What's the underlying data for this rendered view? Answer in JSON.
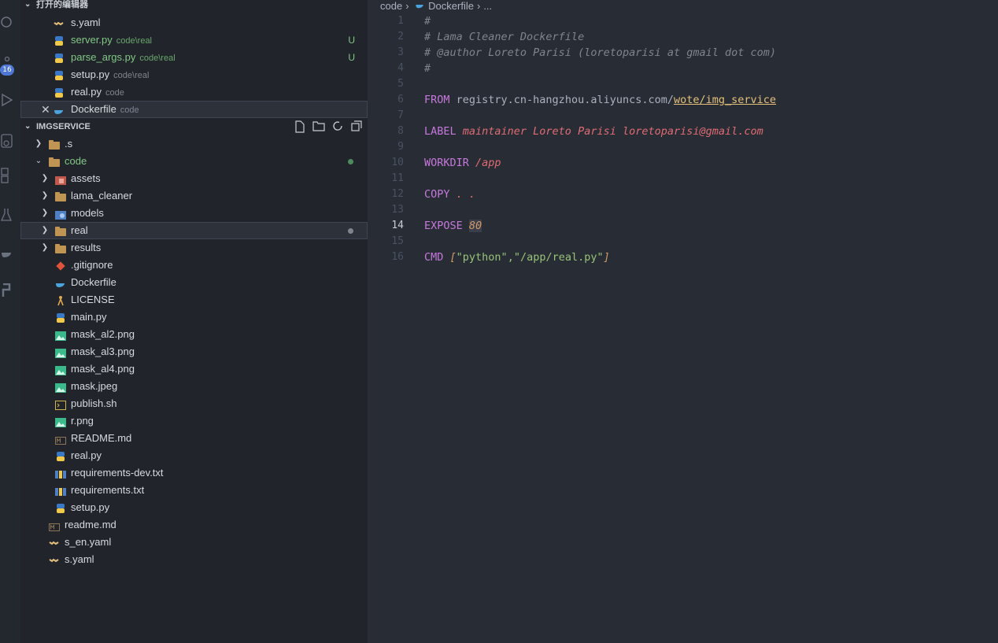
{
  "activity": {
    "badge": "16"
  },
  "open_editors": {
    "title": "打开的编辑器",
    "items": [
      {
        "name": "s.yaml",
        "desc": "",
        "status": ""
      },
      {
        "name": "server.py",
        "desc": "code\\real",
        "status": "U"
      },
      {
        "name": "parse_args.py",
        "desc": "code\\real",
        "status": "U"
      },
      {
        "name": "setup.py",
        "desc": "code\\real",
        "status": ""
      },
      {
        "name": "real.py",
        "desc": "code",
        "status": ""
      },
      {
        "name": "Dockerfile",
        "desc": "code",
        "status": ""
      }
    ]
  },
  "explorer": {
    "title": "IMGSERVICE",
    "items": [
      {
        "name": ".s"
      },
      {
        "name": "code"
      },
      {
        "name": "assets"
      },
      {
        "name": "lama_cleaner"
      },
      {
        "name": "models"
      },
      {
        "name": "real"
      },
      {
        "name": "results"
      },
      {
        "name": ".gitignore"
      },
      {
        "name": "Dockerfile"
      },
      {
        "name": "LICENSE"
      },
      {
        "name": "main.py"
      },
      {
        "name": "mask_al2.png"
      },
      {
        "name": "mask_al3.png"
      },
      {
        "name": "mask_al4.png"
      },
      {
        "name": "mask.jpeg"
      },
      {
        "name": "publish.sh"
      },
      {
        "name": "r.png"
      },
      {
        "name": "README.md"
      },
      {
        "name": "real.py"
      },
      {
        "name": "requirements-dev.txt"
      },
      {
        "name": "requirements.txt"
      },
      {
        "name": "setup.py"
      },
      {
        "name": "readme.md"
      },
      {
        "name": "s_en.yaml"
      },
      {
        "name": "s.yaml"
      }
    ]
  },
  "breadcrumb": {
    "folder": "code",
    "sep": "›",
    "file": "Dockerfile",
    "more": "..."
  },
  "editor": {
    "current_line": "14",
    "line_numbers": [
      "1",
      "2",
      "3",
      "4",
      "5",
      "6",
      "7",
      "8",
      "9",
      "10",
      "11",
      "12",
      "13",
      "14",
      "15",
      "16"
    ],
    "l1": "#",
    "l2": "# Lama Cleaner Dockerfile",
    "l3": "# @author Loreto Parisi (loretoparisi at gmail dot com)",
    "l4": "#",
    "l6_kw": "FROM",
    "l6_a": " registry.cn-hangzhou.aliyuncs.com/",
    "l6_b": "wote/img_service",
    "l8_kw": "LABEL",
    "l8_v": " maintainer Loreto Parisi loretoparisi@gmail.com",
    "l10_kw": "WORKDIR",
    "l10_v": " /app",
    "l12_kw": "COPY",
    "l12_v": " . .",
    "l14_kw": "EXPOSE",
    "l14_v": "80",
    "l16_kw": "CMD",
    "l16_b1": " [",
    "l16_s1": "\"python\"",
    "l16_c": ",",
    "l16_s2": "\"/app/real.py\"",
    "l16_b2": "]"
  }
}
